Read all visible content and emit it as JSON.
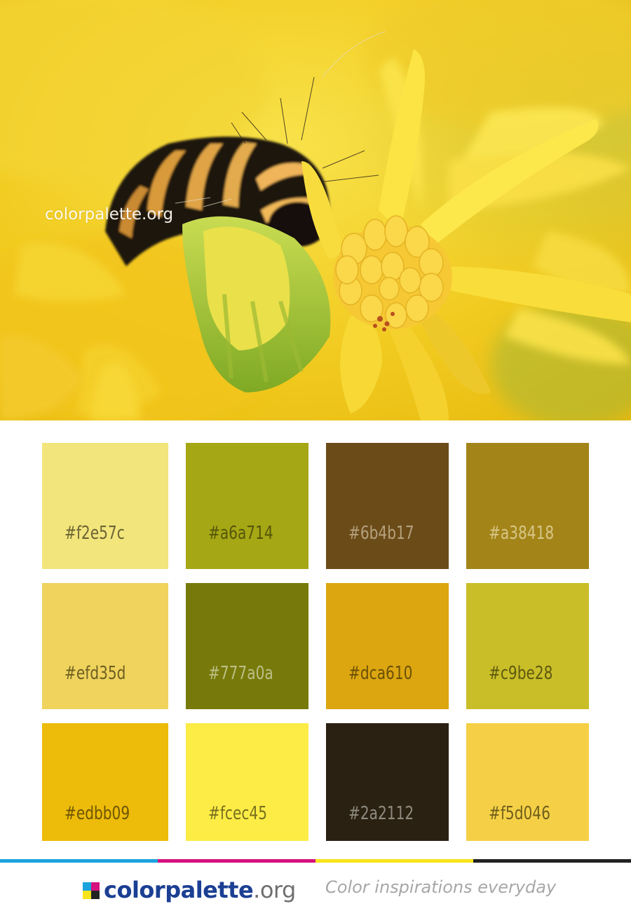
{
  "photo": {
    "watermark": "colorpalette.org",
    "subject": "caterpillar-on-yellow-flower"
  },
  "palette": [
    {
      "hex": "#f2e57c",
      "text_color": "#6b6433"
    },
    {
      "hex": "#a6a714",
      "text_color": "#55560a"
    },
    {
      "hex": "#6b4b17",
      "text_color": "#b4a17e"
    },
    {
      "hex": "#a38418",
      "text_color": "#d7c688"
    },
    {
      "hex": "#efd35d",
      "text_color": "#6e5f22"
    },
    {
      "hex": "#777a0a",
      "text_color": "#bdbf86"
    },
    {
      "hex": "#dca610",
      "text_color": "#6b5006"
    },
    {
      "hex": "#c9be28",
      "text_color": "#5f5910"
    },
    {
      "hex": "#edbb09",
      "text_color": "#6e5605"
    },
    {
      "hex": "#fcec45",
      "text_color": "#786f1e"
    },
    {
      "hex": "#2a2112",
      "text_color": "#8f8a80"
    },
    {
      "hex": "#f5d046",
      "text_color": "#705f1c"
    }
  ],
  "stripes": [
    "#1aa3dc",
    "#d6127f",
    "#f8e41a",
    "#222222"
  ],
  "footer": {
    "logo_name": "colorpalette",
    "logo_tld": ".org",
    "logo_colors": [
      "#1aa3dc",
      "#d6127f",
      "#f8e41a",
      "#222222"
    ],
    "tagline": "Color inspirations everyday"
  }
}
